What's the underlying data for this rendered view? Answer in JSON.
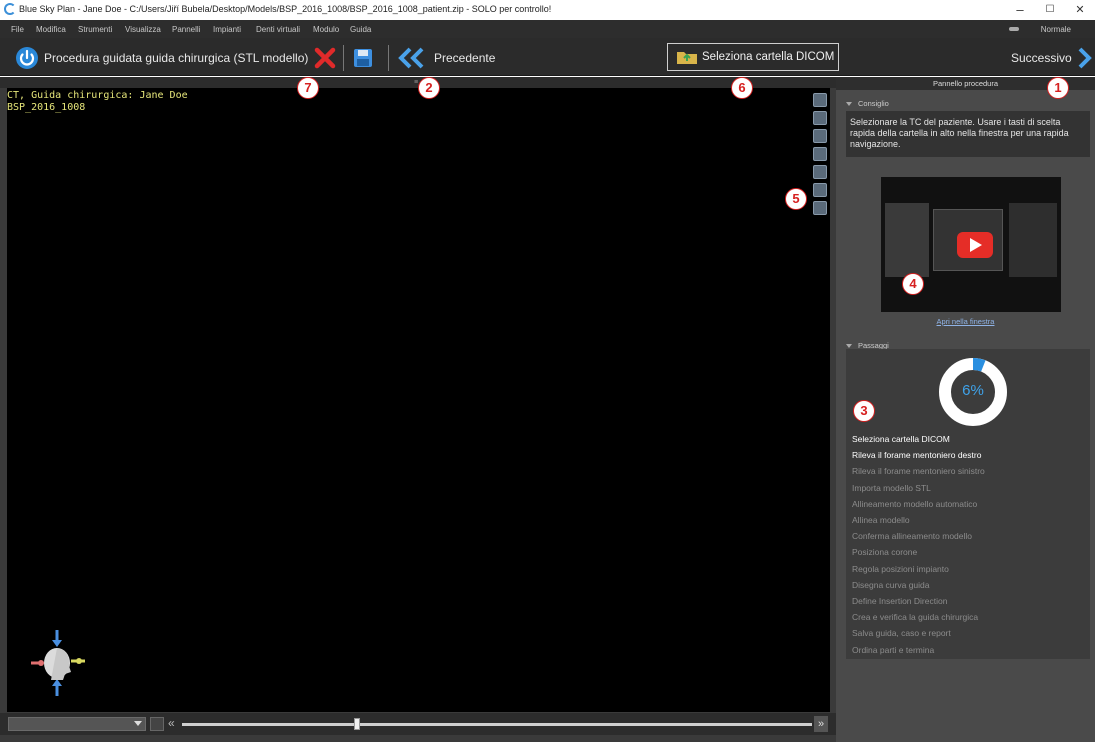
{
  "window": {
    "title": "Blue Sky Plan - Jane Doe - C:/Users/Jiří Bubela/Desktop/Models/BSP_2016_1008/BSP_2016_1008_patient.zip - SOLO per controllo!",
    "minimize": "–",
    "maximize": "☐",
    "close": "✕"
  },
  "menu": {
    "items": [
      "File",
      "Modifica",
      "Strumenti",
      "Visualizza",
      "Pannelli",
      "Impianti",
      "Denti virtuali",
      "Modulo",
      "Guida"
    ],
    "mode": "Normale"
  },
  "toolbar": {
    "title": "Procedura guidata guida chirurgica (STL modello)",
    "previous": "Precedente",
    "select_dicom": "Seleziona cartella DICOM",
    "next": "Successivo"
  },
  "viewport": {
    "caption_line1": "CT, Guida chirurgica: Jane Doe",
    "caption_line2": "BSP_2016_1008",
    "divider": "≡"
  },
  "panel": {
    "header": "Pannello procedura",
    "advice_title": "Consiglio",
    "advice_text": "Selezionare la TC del paziente. Usare i tasti di scelta rapida della cartella in alto nella finestra per una rapida navigazione.",
    "open_in_window": "Apri nella finestra",
    "steps_title": "Passaggi",
    "progress_label": "6%",
    "progress_fraction": 0.06,
    "steps": [
      {
        "label": "Seleziona cartella DICOM",
        "active": true
      },
      {
        "label": "Rileva il forame mentoniero destro",
        "active": true
      },
      {
        "label": "Rileva il forame mentoniero sinistro",
        "active": false
      },
      {
        "label": "Importa modello STL",
        "active": false
      },
      {
        "label": "Allineamento modello automatico",
        "active": false
      },
      {
        "label": "Allinea modello",
        "active": false
      },
      {
        "label": "Conferma allineamento modello",
        "active": false
      },
      {
        "label": "Posiziona corone",
        "active": false
      },
      {
        "label": "Regola posizioni impianto",
        "active": false
      },
      {
        "label": "Disegna curva guida",
        "active": false
      },
      {
        "label": "Define Insertion Direction",
        "active": false
      },
      {
        "label": "Crea e verifica la guida chirurgica",
        "active": false
      },
      {
        "label": "Salva guida, caso e report",
        "active": false
      },
      {
        "label": "Ordina parti e termina",
        "active": false
      }
    ]
  },
  "callouts": [
    "1",
    "2",
    "3",
    "4",
    "5",
    "6",
    "7"
  ],
  "colors": {
    "accent": "#3fa3ea",
    "callout": "#d62020",
    "caption": "#e6e67a"
  }
}
